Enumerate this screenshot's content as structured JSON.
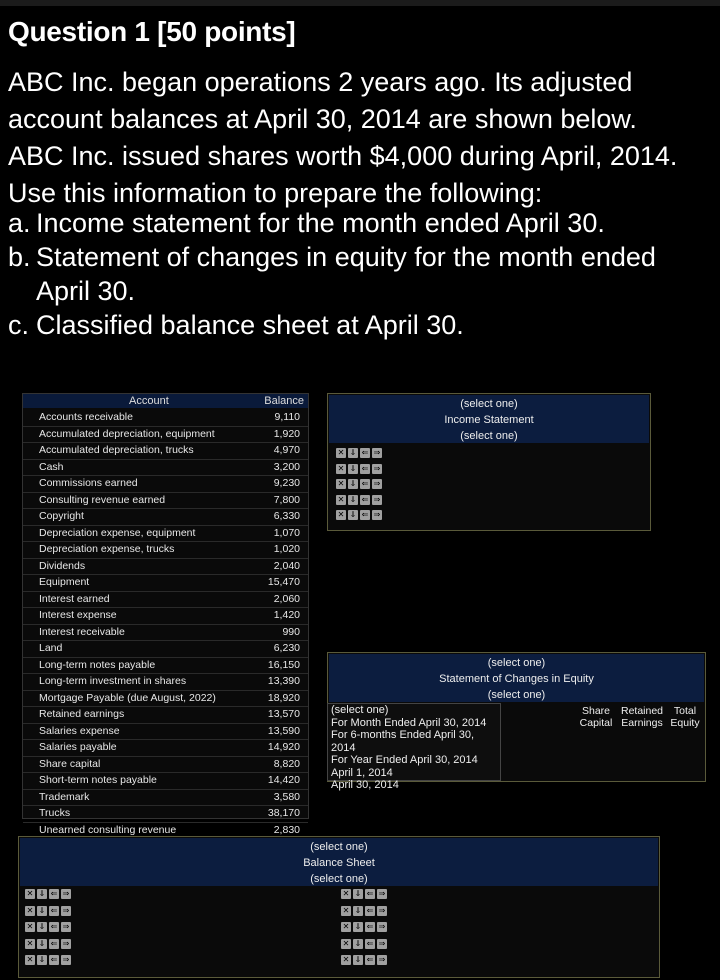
{
  "question": {
    "title": "Question 1 [50 points]",
    "paragraph_lines": [
      "ABC Inc. began operations 2 years ago. Its adjusted",
      "account balances at April 30, 2014 are shown below.",
      "ABC Inc. issued shares worth $4,000 during April, 2014.",
      "Use this information to prepare the following:"
    ],
    "tasks": [
      {
        "label": "a.",
        "text": "Income statement for the month ended April 30."
      },
      {
        "label": "b.",
        "text": "Statement of changes in equity for the month ended April 30."
      },
      {
        "label": "c.",
        "text": "Classified balance sheet at April 30."
      }
    ]
  },
  "accounts": {
    "header_account": "Account",
    "header_balance": "Balance",
    "rows": [
      {
        "name": "Accounts receivable",
        "balance": "9,110"
      },
      {
        "name": "Accumulated depreciation, equipment",
        "balance": "1,920"
      },
      {
        "name": "Accumulated depreciation, trucks",
        "balance": "4,970"
      },
      {
        "name": "Cash",
        "balance": "3,200"
      },
      {
        "name": "Commissions earned",
        "balance": "9,230"
      },
      {
        "name": "Consulting revenue earned",
        "balance": "7,800"
      },
      {
        "name": "Copyright",
        "balance": "6,330"
      },
      {
        "name": "Depreciation expense, equipment",
        "balance": "1,070"
      },
      {
        "name": "Depreciation expense, trucks",
        "balance": "1,020"
      },
      {
        "name": "Dividends",
        "balance": "2,040"
      },
      {
        "name": "Equipment",
        "balance": "15,470"
      },
      {
        "name": "Interest earned",
        "balance": "2,060"
      },
      {
        "name": "Interest expense",
        "balance": "1,420"
      },
      {
        "name": "Interest receivable",
        "balance": "990"
      },
      {
        "name": "Land",
        "balance": "6,230"
      },
      {
        "name": "Long-term notes payable",
        "balance": "16,150"
      },
      {
        "name": "Long-term investment in shares",
        "balance": "13,390"
      },
      {
        "name": "Mortgage Payable (due August, 2022)",
        "balance": "18,920"
      },
      {
        "name": "Retained earnings",
        "balance": "13,570"
      },
      {
        "name": "Salaries expense",
        "balance": "13,590"
      },
      {
        "name": "Salaries payable",
        "balance": "14,920"
      },
      {
        "name": "Share capital",
        "balance": "8,820"
      },
      {
        "name": "Short-term notes payable",
        "balance": "14,420"
      },
      {
        "name": "Trademark",
        "balance": "3,580"
      },
      {
        "name": "Trucks",
        "balance": "38,170"
      },
      {
        "name": "Unearned consulting revenue",
        "balance": "2,830"
      }
    ]
  },
  "income_statement": {
    "select1": "(select one)",
    "title": "Income Statement",
    "select2": "(select one)"
  },
  "equity": {
    "select1": "(select one)",
    "title": "Statement of Changes in Equity",
    "select2": "(select one)",
    "dropdown_options": [
      "(select one)",
      "For Month Ended April 30, 2014",
      "For 6-months Ended April 30, 2014",
      "For Year Ended April 30, 2014",
      "April 1, 2014",
      "April 30, 2014"
    ],
    "col_share_capital": "Share Capital",
    "col_retained_earnings": "Retained Earnings",
    "col_total_equity": "Total Equity"
  },
  "balance_sheet": {
    "select1": "(select one)",
    "title": "Balance Sheet",
    "select2": "(select one)"
  },
  "row_controls": {
    "icons": [
      "delete-icon",
      "insert-below-icon",
      "outdent-icon",
      "indent-icon"
    ],
    "glyphs": [
      "✕",
      "⇓",
      "⇐",
      "⇒"
    ]
  }
}
